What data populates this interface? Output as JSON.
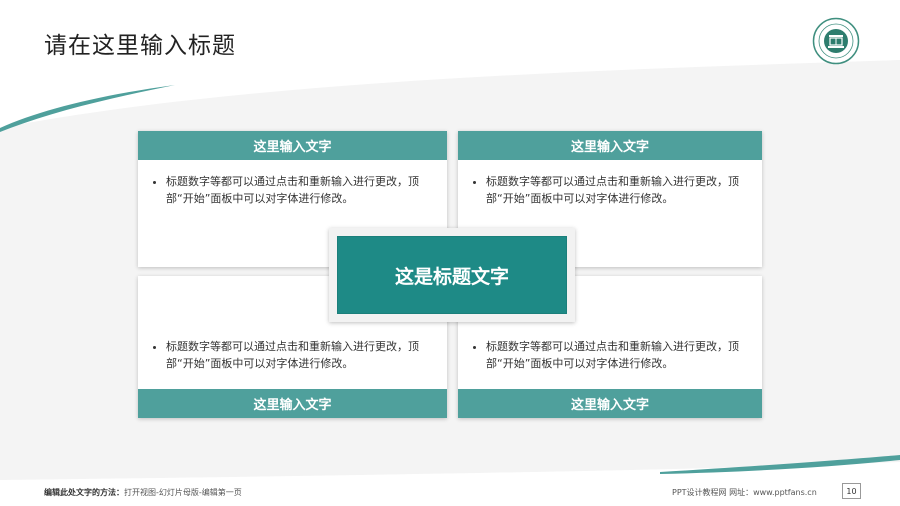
{
  "slide": {
    "title": "请在这里输入标题",
    "center_title": "这是标题文字"
  },
  "colors": {
    "accent": "#4fa09c",
    "accent_dark": "#1e8a86",
    "background_gray": "#f2f2f2"
  },
  "logo": {
    "icon": "university-seal-icon"
  },
  "cards": [
    {
      "header": "这里输入文字",
      "bullet": "标题数字等都可以通过点击和重新输入进行更改，顶部“开始”面板中可以对字体进行修改。"
    },
    {
      "header": "这里输入文字",
      "bullet": "标题数字等都可以通过点击和重新输入进行更改，顶部“开始”面板中可以对字体进行修改。"
    },
    {
      "header": "这里输入文字",
      "bullet": "标题数字等都可以通过点击和重新输入进行更改，顶部“开始”面板中可以对字体进行修改。"
    },
    {
      "header": "这里输入文字",
      "bullet": "标题数字等都可以通过点击和重新输入进行更改，顶部“开始”面板中可以对字体进行修改。"
    }
  ],
  "footer": {
    "left_bold": "编辑此处文字的方法：",
    "left_text": "打开视图-幻灯片母版-编辑第一页",
    "right_text": "PPT设计教程网   网址：www.pptfans.cn",
    "page_number": "10"
  }
}
